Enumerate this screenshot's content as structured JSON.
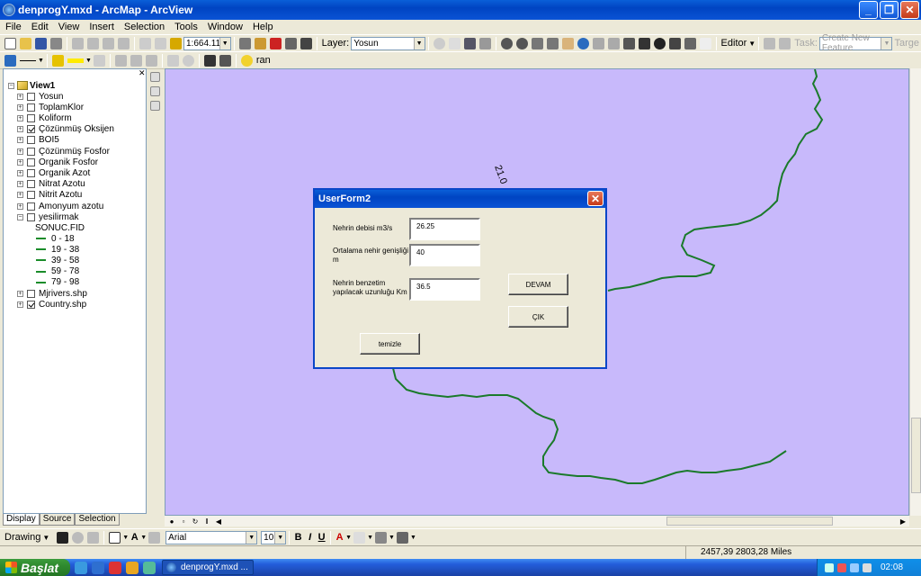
{
  "window": {
    "title": "denprogY.mxd - ArcMap - ArcView"
  },
  "menu": [
    "File",
    "Edit",
    "View",
    "Insert",
    "Selection",
    "Tools",
    "Window",
    "Help"
  ],
  "toolbar": {
    "scale_value": "1:664.114",
    "layer_label": "Layer:",
    "layer_value": "Yosun",
    "editor_label": "Editor",
    "task_label": "Task:",
    "task_value": "Create New Feature",
    "target_label": "Targe",
    "ran_label": "ran"
  },
  "toc": {
    "root": "View1",
    "layers": [
      {
        "name": "Yosun",
        "checked": false
      },
      {
        "name": "ToplamKlor",
        "checked": false
      },
      {
        "name": "Koliform",
        "checked": false
      },
      {
        "name": "Çözünmüş Oksijen",
        "checked": true
      },
      {
        "name": "BOI5",
        "checked": false
      },
      {
        "name": "Çözünmüş Fosfor",
        "checked": false
      },
      {
        "name": "Organik Fosfor",
        "checked": false
      },
      {
        "name": "Organik Azot",
        "checked": false
      },
      {
        "name": "Nitrat Azotu",
        "checked": false
      },
      {
        "name": "Nitrit Azotu",
        "checked": false
      },
      {
        "name": "Amonyum azotu",
        "checked": false
      },
      {
        "name": "yesilirmak",
        "checked": false
      }
    ],
    "legend_field": "SONUC.FID",
    "legend_items": [
      "0 - 18",
      "19 - 38",
      "39 - 58",
      "59 - 78",
      "79 - 98"
    ],
    "bottom_layers": [
      {
        "name": "Mjrivers.shp",
        "checked": false
      },
      {
        "name": "Country.shp",
        "checked": true
      }
    ],
    "tabs": [
      "Display",
      "Source",
      "Selection"
    ]
  },
  "map": {
    "annotation": "21.0",
    "background_color": "#c8b9fb",
    "river_color": "#1a7a2a"
  },
  "dialog": {
    "title": "UserForm2",
    "fields": [
      {
        "label": "Nehrin debisi m3/s",
        "value": "26.25"
      },
      {
        "label": "Ortalama nehir genişliği m",
        "value": "40"
      },
      {
        "label": "Nehrin benzetim yapılacak uzunluğu Km",
        "value": "36.5"
      }
    ],
    "devam_label": "DEVAM",
    "cik_label": "ÇIK",
    "temizle_label": "temizle"
  },
  "drawing": {
    "label": "Drawing",
    "font": "Arial",
    "size": "10"
  },
  "status": {
    "coordinates": "2457,39  2803,28 Miles"
  },
  "taskbar": {
    "start_label": "Başlat",
    "task": "denprogY.mxd ...",
    "lang": "TR",
    "time": "02:08"
  }
}
